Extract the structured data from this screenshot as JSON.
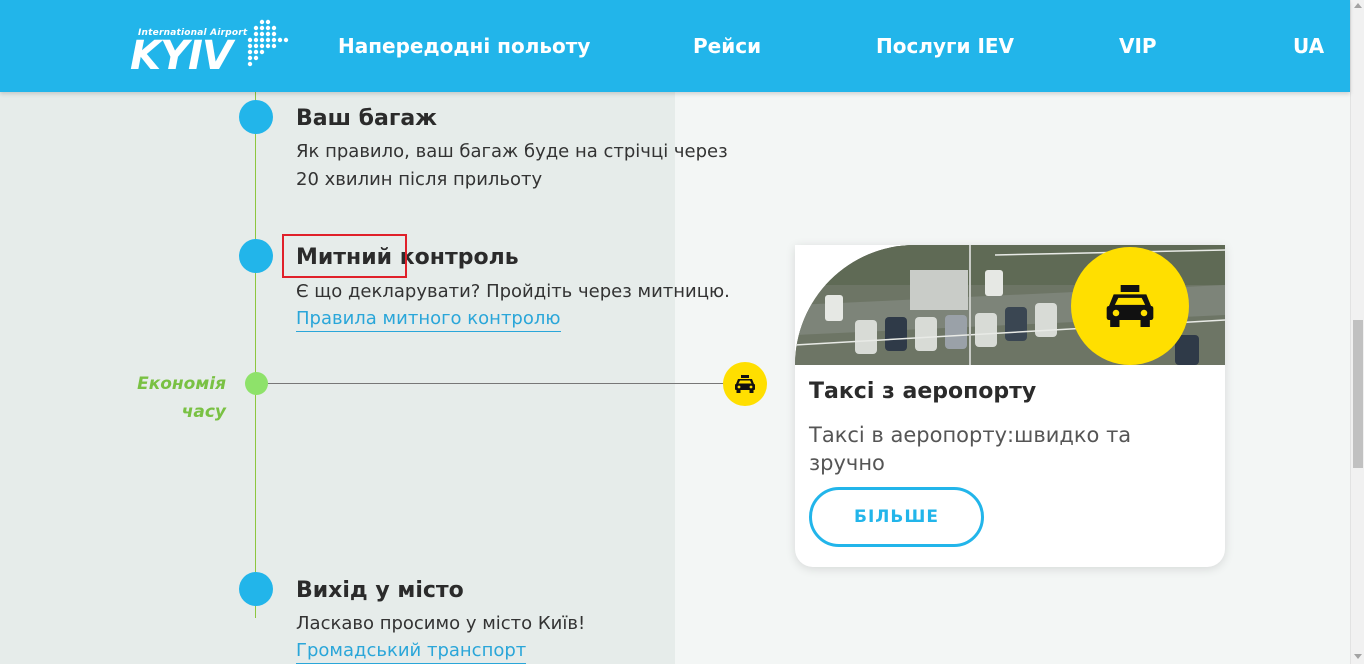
{
  "header": {
    "logo_subtitle": "International Airport",
    "logo_main": "KYIV",
    "nav": [
      {
        "label": "Напередодні польоту"
      },
      {
        "label": "Рейси"
      },
      {
        "label": "Послуги IEV"
      },
      {
        "label": "VIP"
      },
      {
        "label": "UA"
      }
    ]
  },
  "timeline": {
    "steps": [
      {
        "title": "Ваш багаж",
        "desc_line1": "Як правило, ваш багаж буде на стрічці через",
        "desc_line2": "20 хвилин після прильоту"
      },
      {
        "title": "Митний контроль",
        "desc": "Є що декларувати? Пройдіть через митницю.",
        "link": "Правила митного контролю"
      },
      {
        "title": "Вихід у місто",
        "desc": "Ласкаво просимо у місто Київ!",
        "link": "Громадський транспорт"
      }
    ],
    "economy": {
      "line1": "Економія",
      "line2": "часу"
    }
  },
  "card": {
    "title": "Таксі з аеропорту",
    "desc": "Таксі в аеропорту:швидко та зручно",
    "button": "БІЛЬШЕ",
    "icon": "taxi-icon"
  },
  "colors": {
    "header": "#22b5ea",
    "accent_blue": "#22b5ea",
    "timeline_green": "#8dc63f",
    "taxi_yellow": "#ffdf00",
    "highlight_red": "#e0202a"
  }
}
